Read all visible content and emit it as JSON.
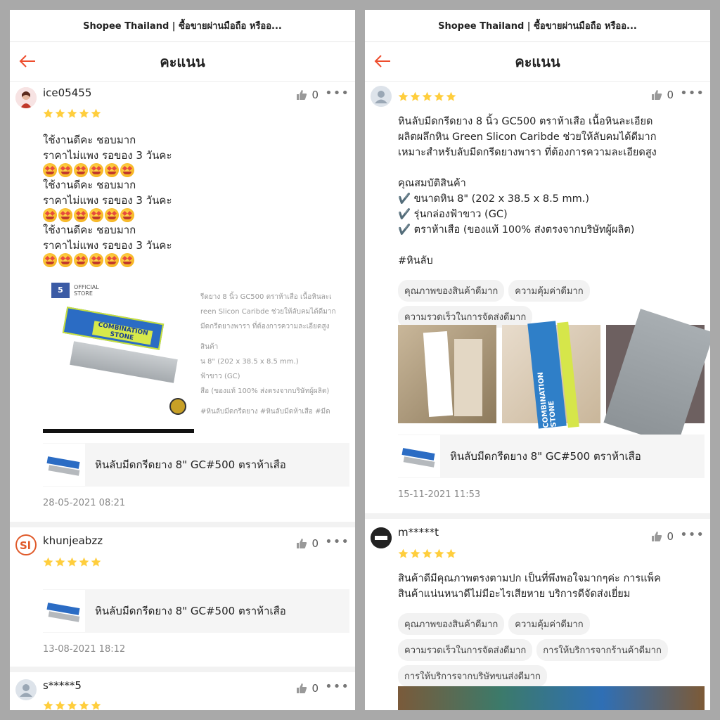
{
  "browser_title": "Shopee Thailand | ซื้อขายผ่านมือถือ หรืออ...",
  "header_title": "คะแนน",
  "left_reviews": [
    {
      "username": "ice05455",
      "likes": "0",
      "rating": 5,
      "text_lines": [
        "ใช้งานดีคะ ชอบมาก",
        "ราคาไม่แพง รอของ 3 วันคะ",
        "ใช้งานดีคะ ชอบมาก",
        "ราคาไม่แพง รอของ 3 วันคะ",
        "ใช้งานดีคะ ชอบมาก",
        "ราคาไม่แพง รอของ 3 วันคะ"
      ],
      "image_official_store": "OFFICIAL STORE",
      "image_stone_label": "COMBINATION STONE",
      "image_text_lines": [
        "รีดยาง 8 นิ้ว GC500 ตราห้าเสือ  เนื้อหินละเ",
        "reen Slicon Caribde ช่วยให้ลับคมได้ดีมาก",
        "มีดกรีดยางพารา ที่ต้องการความละเอียดสูง",
        "สินค้า",
        "น 8\" (202 x 38.5 x 8.5 mm.)",
        "ฟ้าขาว (GC)",
        "สือ (ของแท้ 100% ส่งตรงจากบริษัทผู้ผลิต)",
        "#หินลับมีดกรีดยาง #หินลับมีดห้าเสือ #มีด"
      ],
      "product_name": "หินลับมีดกรีดยาง 8\" GC#500 ตราห้าเสือ",
      "date": "28-05-2021 08:21"
    },
    {
      "username": "khunjeabzz",
      "likes": "0",
      "rating": 5,
      "product_name": "หินลับมีดกรีดยาง 8\" GC#500 ตราห้าเสือ",
      "date": "13-08-2021 18:12"
    },
    {
      "username": "s*****5",
      "likes": "0",
      "rating": 5
    }
  ],
  "right_reviews": [
    {
      "likes": "0",
      "rating": 5,
      "text": "หินลับมีดกรีดยาง 8 นิ้ว GC500 ตราห้าเสือ  เนื้อหินละเอียด\nผลิตผลึกหิน Green Slicon Caribde ช่วยให้ลับคมได้ดีมาก\nเหมาะสำหรับลับมีดกรีดยางพารา ที่ต้องการความละเอียดสูง\n\nคุณสมบัติสินค้า\n✔️ ขนาดหิน 8\" (202 x 38.5 x 8.5 mm.)\n✔️ รุ่นกล่องฟ้าขาว (GC)\n✔️ ตราห้าเสือ (ของแท้ 100% ส่งตรงจากบริษัทผู้ผลิต)\n\n#หินลับ",
      "tags": [
        "คุณภาพของสินค้าดีมาก",
        "ความคุ้มค่าดีมาก",
        "ความรวดเร็วในการจัดส่งดีมาก"
      ],
      "photo_stone_label": "COMBINATION STONE",
      "product_name": "หินลับมีดกรีดยาง 8\" GC#500 ตราห้าเสือ",
      "date": "15-11-2021 11:53"
    },
    {
      "username": "m*****t",
      "likes": "0",
      "rating": 5,
      "text": "สินค้าดีมีคุณภาพตรงตามปก เป็นที่พึงพอใจมากๆค่ะ การแพ็ค\nสินค้าแน่นหนาดีไม่มีอะไรเสียหาย บริการดีจัดส่งเยี่ยม",
      "tags": [
        "คุณภาพของสินค้าดีมาก",
        "ความคุ้มค่าดีมาก",
        "ความรวดเร็วในการจัดส่งดีมาก",
        "การให้บริการจากร้านค้าดีมาก",
        "การให้บริการจากบริษัทขนส่งดีมาก"
      ]
    }
  ],
  "colors": {
    "accent": "#ee4d2d",
    "star": "#ffce3d"
  }
}
